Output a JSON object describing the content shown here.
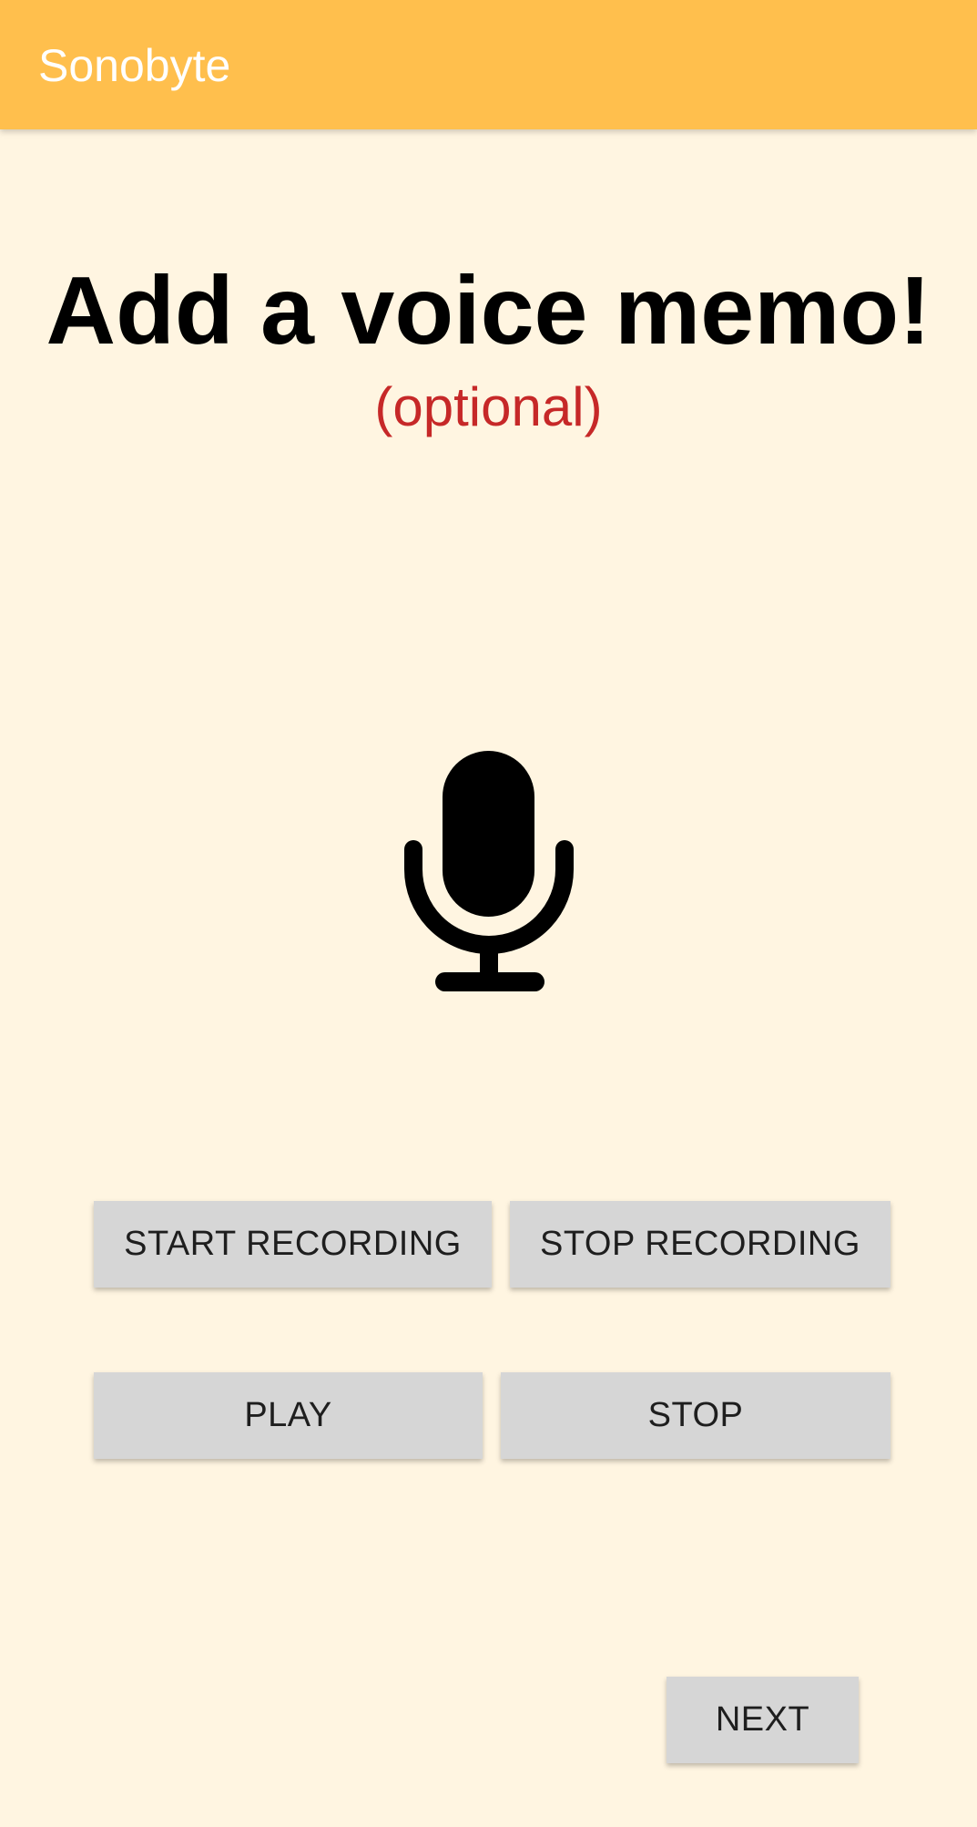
{
  "app_bar": {
    "title": "Sonobyte",
    "color": "#FFBF4D"
  },
  "main": {
    "headline": "Add a voice memo!",
    "subtitle": "(optional)",
    "subtitle_color": "#C62828",
    "icon": "microphone-icon"
  },
  "controls": {
    "start_recording_label": "START RECORDING",
    "stop_recording_label": "STOP RECORDING",
    "play_label": "PLAY",
    "stop_label": "STOP"
  },
  "footer": {
    "next_label": "NEXT"
  },
  "colors": {
    "background": "#FFF5E1",
    "button": "#D6D6D6"
  }
}
